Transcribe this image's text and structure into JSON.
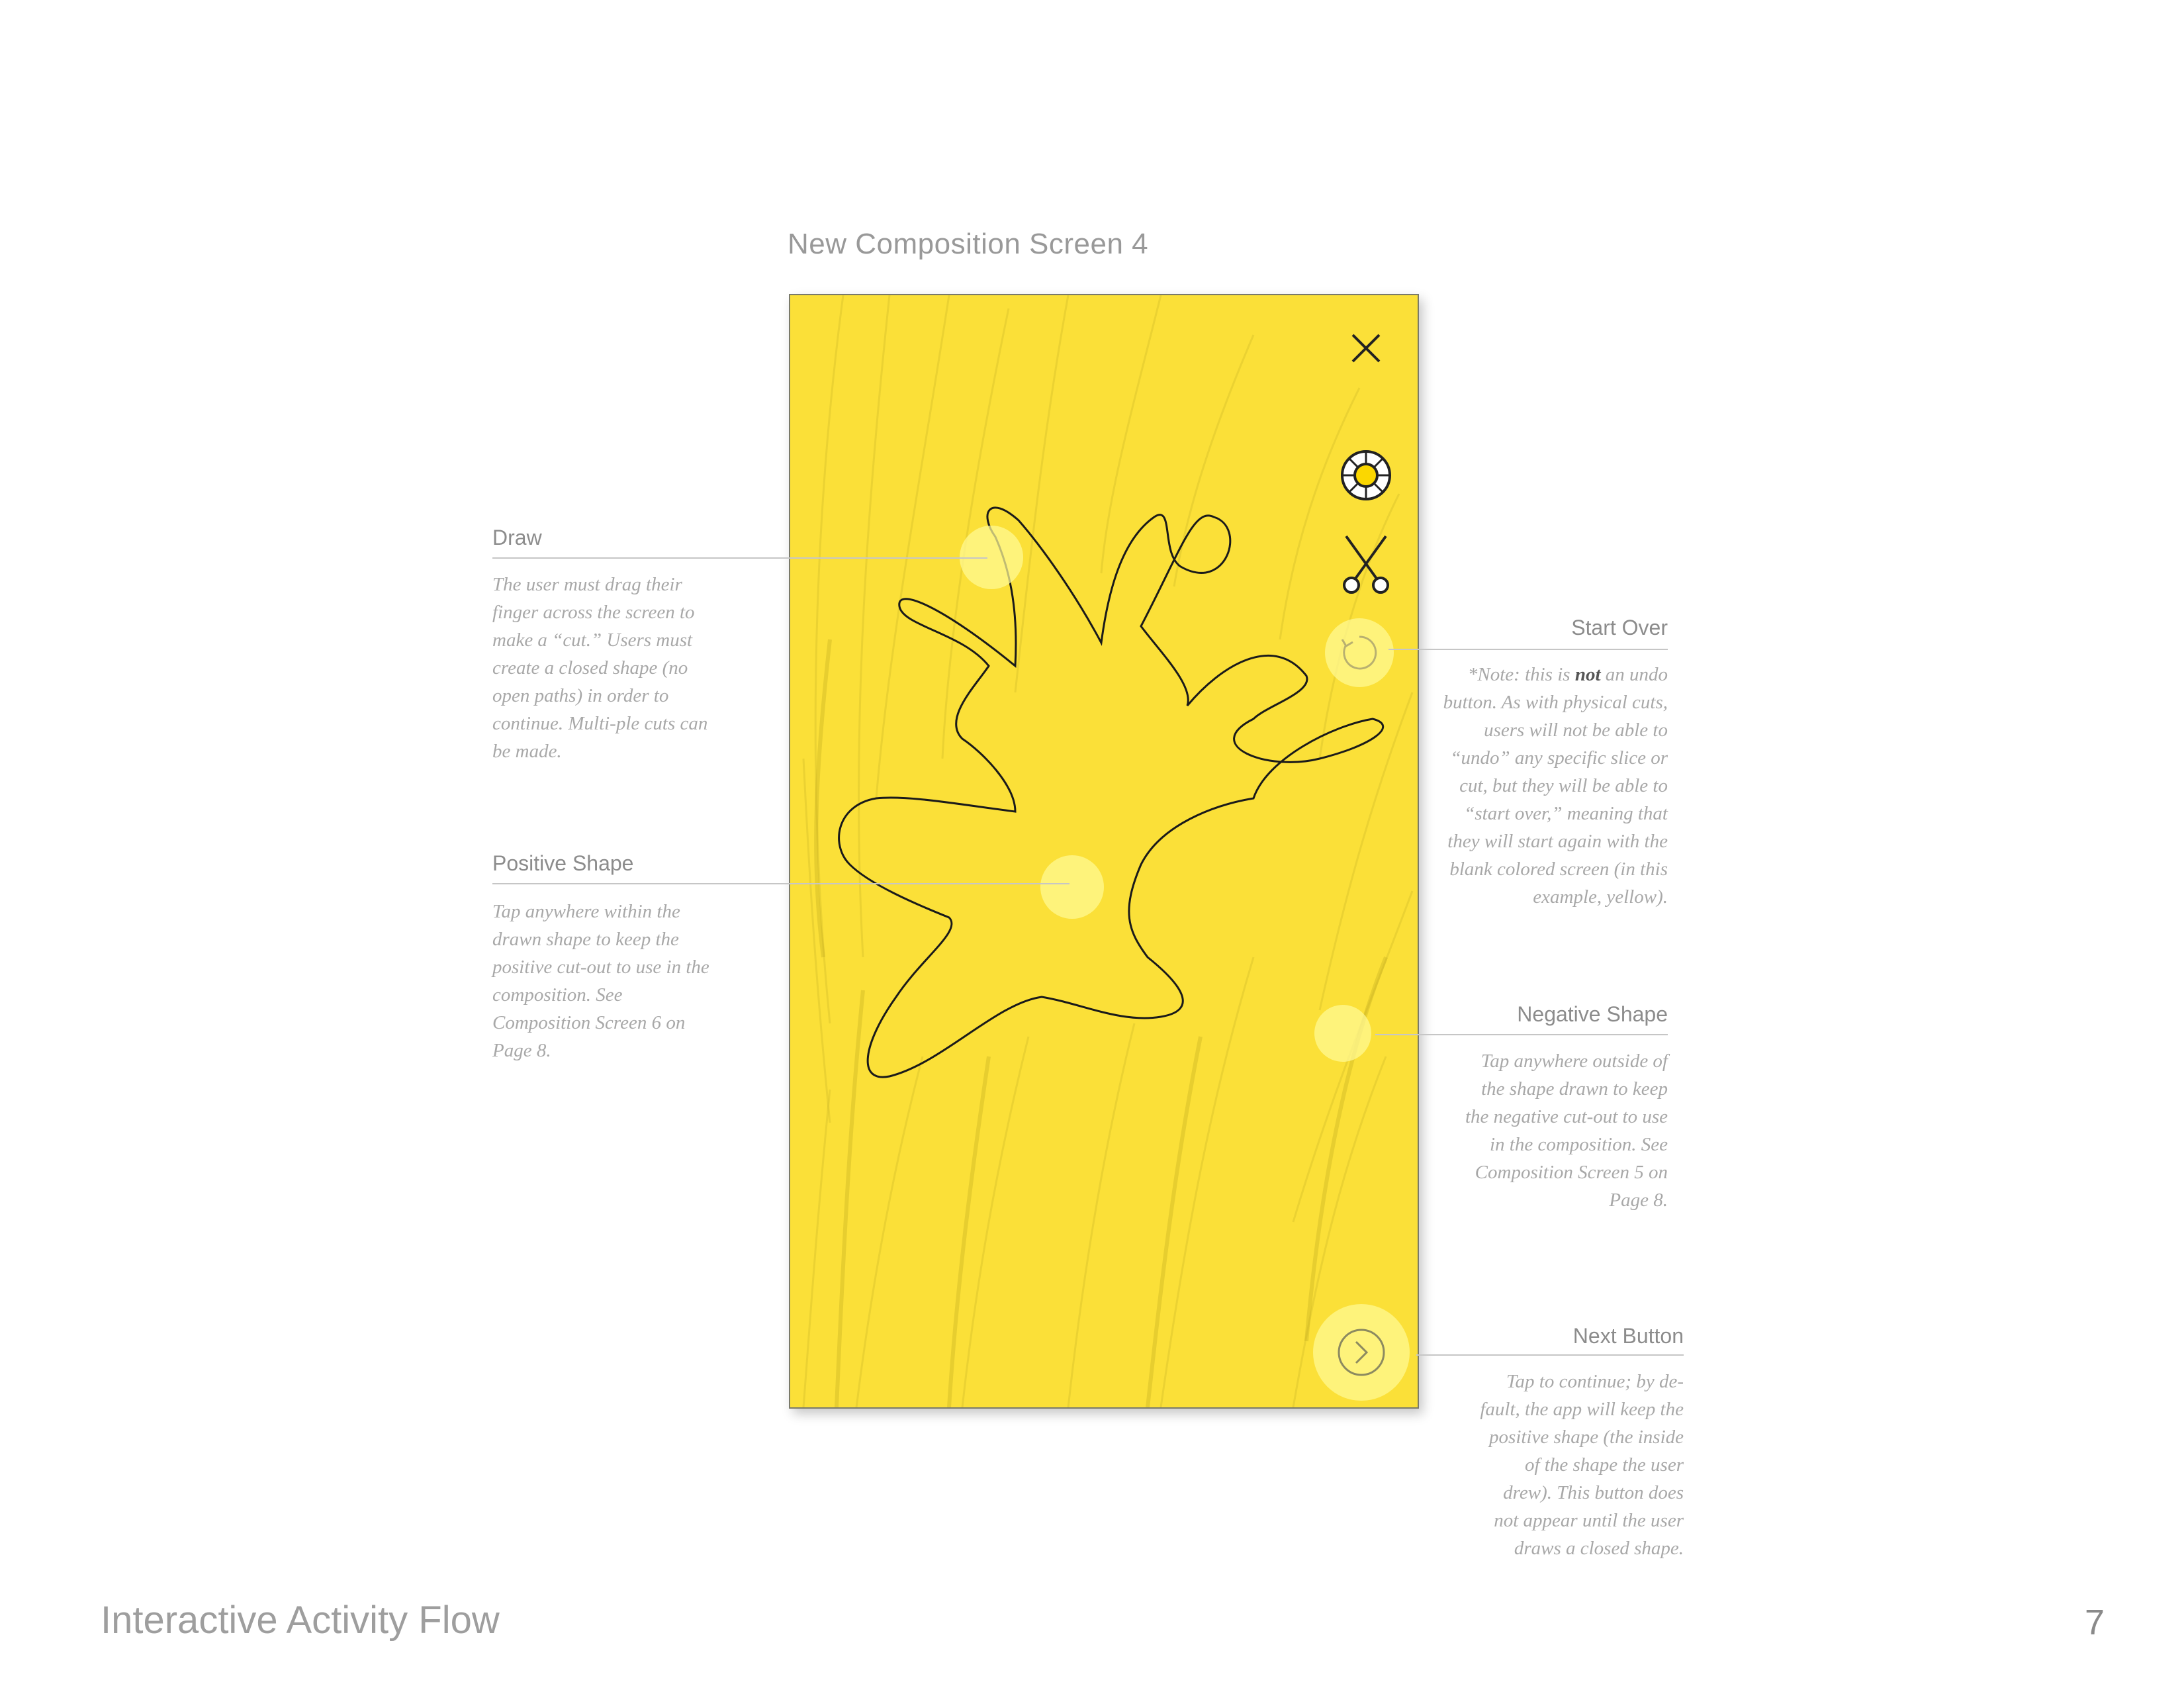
{
  "screen_title": "New Composition Screen 4",
  "phone": {
    "background_color": "#fbe038",
    "icons": {
      "close": "close-icon",
      "color_wheel": "color-wheel-icon",
      "scissors": "scissors-icon",
      "start_over": "start-over-icon",
      "next": "next-arrow-icon"
    }
  },
  "annotations": {
    "draw": {
      "title": "Draw",
      "text": "The user must drag their finger across the screen to make a “cut.” Users must create a closed shape (no open paths) in order to continue. Multi-ple cuts can be made."
    },
    "positive_shape": {
      "title": "Positive Shape",
      "text": "Tap anywhere within the drawn shape to keep the positive cut-out to use in the composition. See Composition Screen 6 on Page 8."
    },
    "start_over": {
      "title": "Start Over",
      "text_before": "*Note: this is ",
      "text_bold": "not",
      "text_after": " an undo button. As with physical cuts, users will not be able to “undo” any specific slice or cut, but they will be able to “start over,” meaning that they will start again with the blank colored screen (in this example, yellow)."
    },
    "negative_shape": {
      "title": "Negative Shape",
      "text": "Tap anywhere outside of the shape drawn to keep the negative cut-out to use in the composition. See Composition Screen 5 on Page 8."
    },
    "next_button": {
      "title": "Next Button",
      "text": "Tap to continue; by de-fault, the app will keep the positive shape (the inside of the shape the user drew). This button does not appear until the user draws a closed shape."
    }
  },
  "footer": {
    "title": "Interactive Activity Flow",
    "page_number": "7"
  }
}
